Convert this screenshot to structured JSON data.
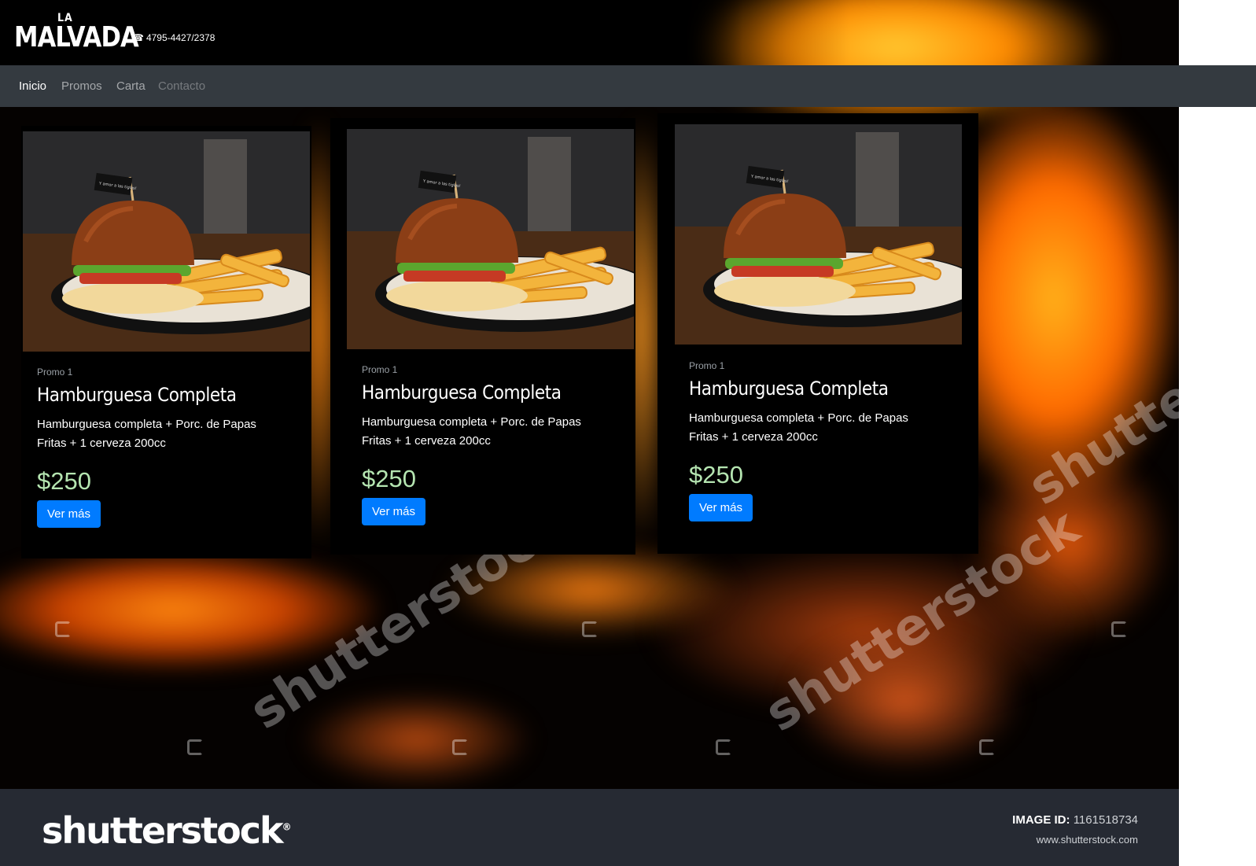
{
  "brand": {
    "logo_top": "LA",
    "logo_main": "MALVADA",
    "phone_icon": "☎",
    "phone": "4795-4427/2378"
  },
  "nav": {
    "items": [
      {
        "label": "Inicio"
      },
      {
        "label": "Promos"
      },
      {
        "label": "Carta"
      },
      {
        "label": "Contacto"
      }
    ]
  },
  "cards": [
    {
      "subtitle": "Promo 1",
      "title": "Hamburguesa Completa",
      "text": "Hamburguesa completa + Porc. de Papas Fritas + 1 cerveza 200cc",
      "price": "$250",
      "button": "Ver más",
      "flag_text": "Y amor a las tiglas!"
    },
    {
      "subtitle": "Promo 1",
      "title": "Hamburguesa Completa",
      "text": "Hamburguesa completa + Porc. de Papas Fritas + 1 cerveza 200cc",
      "price": "$250",
      "button": "Ver más",
      "flag_text": "Y amor a las tiglas!"
    },
    {
      "subtitle": "Promo 1",
      "title": "Hamburguesa Completa",
      "text": "Hamburguesa completa + Porc. de Papas Fritas + 1 cerveza 200cc",
      "price": "$250",
      "button": "Ver más",
      "flag_text": "Y amor a las tiglas!"
    }
  ],
  "watermark": {
    "text": "shutterstock"
  },
  "footer": {
    "logo": "shutterstock",
    "logo_mark": "®",
    "image_id_label": "IMAGE ID:",
    "image_id": "1161518734",
    "url": "www.shutterstock.com"
  },
  "colors": {
    "navbar": "#343a40",
    "button": "#007bff",
    "price": "#b5e5b1",
    "footer": "#262a33"
  }
}
